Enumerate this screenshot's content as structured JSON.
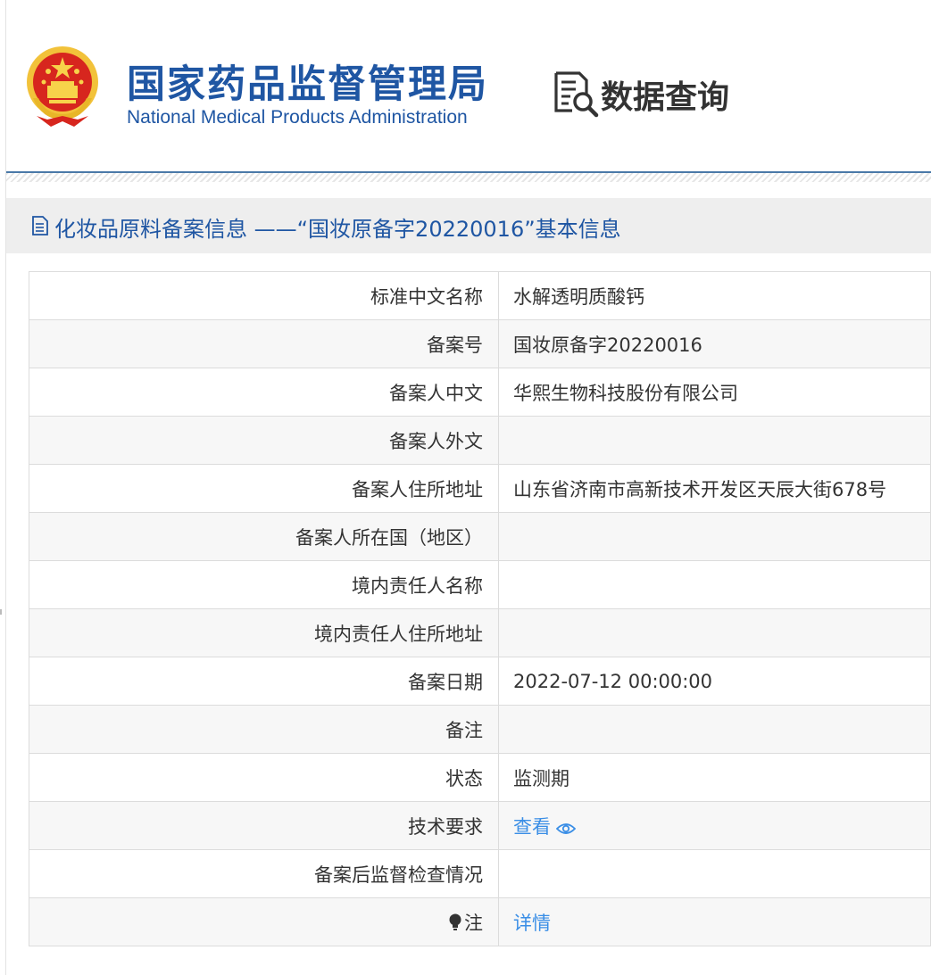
{
  "header": {
    "org_name_cn": "国家药品监督管理局",
    "org_name_en": "National Medical Products Administration",
    "system_title": "数据查询",
    "emblem_icon": "national-emblem-icon",
    "search_icon": "document-search-icon",
    "brand_color": "#1f56a3"
  },
  "section": {
    "icon": "document-icon",
    "title": "化妆品原料备案信息 ——“国妆原备字20220016”基本信息"
  },
  "rows": [
    {
      "label": "标准中文名称",
      "value": "水解透明质酸钙"
    },
    {
      "label": "备案号",
      "value": "国妆原备字20220016"
    },
    {
      "label": "备案人中文",
      "value": "华熙生物科技股份有限公司"
    },
    {
      "label": "备案人外文",
      "value": ""
    },
    {
      "label": "备案人住所地址",
      "value": "山东省济南市高新技术开发区天辰大街678号"
    },
    {
      "label": "备案人所在国（地区）",
      "value": ""
    },
    {
      "label": "境内责任人名称",
      "value": ""
    },
    {
      "label": "境内责任人住所地址",
      "value": ""
    },
    {
      "label": "备案日期",
      "value": "2022-07-12 00:00:00"
    },
    {
      "label": "备注",
      "value": ""
    },
    {
      "label": "状态",
      "value": "监测期"
    },
    {
      "label": "技术要求",
      "link": "查看",
      "icon": "eye-icon"
    },
    {
      "label": "备案后监督检查情况",
      "value": ""
    },
    {
      "label": "注",
      "label_icon": "lightbulb-icon",
      "link": "详情"
    }
  ],
  "link_color": "#3a8ee6"
}
